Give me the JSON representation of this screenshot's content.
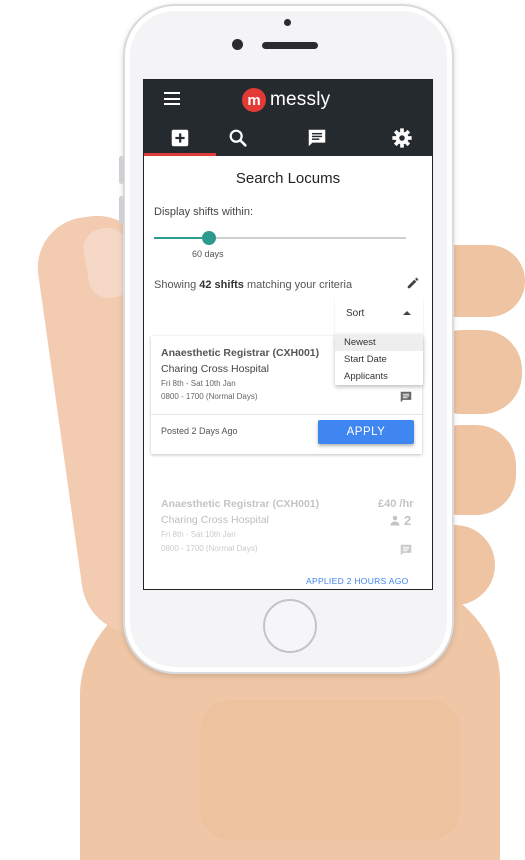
{
  "app": {
    "logo_mark": "m",
    "logo_text": "messly"
  },
  "nav": {
    "tabs": [
      {
        "name": "add-shift",
        "icon": "plus-box-icon",
        "active": true
      },
      {
        "name": "search",
        "icon": "search-icon",
        "active": false
      },
      {
        "name": "messages",
        "icon": "message-icon",
        "active": false
      },
      {
        "name": "settings",
        "icon": "gear-icon",
        "active": false
      }
    ]
  },
  "page": {
    "title": "Search Locums",
    "display_label": "Display shifts within:",
    "slider_value_label": "60 days",
    "slider_fraction": 0.22,
    "count_prefix": "Showing ",
    "count_value": "42 shifts",
    "count_suffix": " matching your criteria"
  },
  "sort": {
    "label": "Sort",
    "options": [
      "Newest",
      "Start Date",
      "Applicants"
    ],
    "selected": "Newest"
  },
  "shifts": [
    {
      "role": "Anaesthetic Registrar (CXH001)",
      "hospital": "Charing Cross Hospital",
      "dates": "Fri 8th - Sat 10th Jan",
      "hours": "0800 - 1700 (Normal Days)",
      "posted": "Posted 2 Days Ago",
      "action_label": "APPLY"
    },
    {
      "role": "Anaesthetic Registrar (CXH001)",
      "hospital": "Charing Cross Hospital",
      "dates": "Fri 8th - Sat 10th Jan",
      "hours": "0800 - 1700 (Normal Days)",
      "rate": "£40 /hr",
      "applicants": "2",
      "status": "APPLIED 2 HOURS AGO"
    }
  ],
  "colors": {
    "topbar": "#252a2f",
    "brand_red": "#e43a36",
    "accent_teal": "#2e9a8e",
    "apply_blue": "#3f86f0"
  }
}
